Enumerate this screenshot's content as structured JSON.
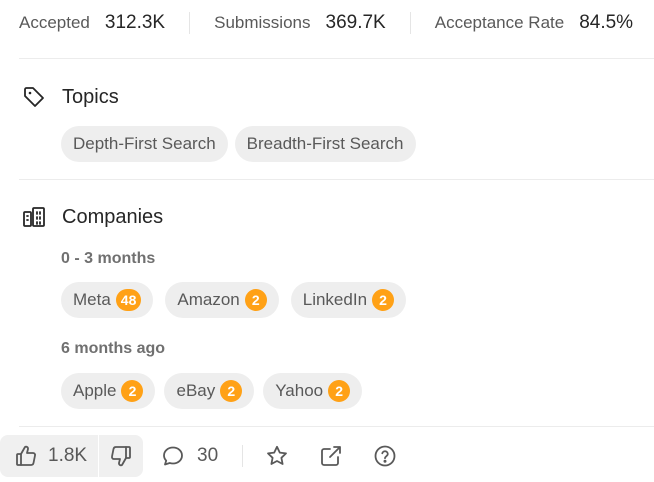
{
  "stats": [
    {
      "label": "Accepted",
      "value": "312.3K"
    },
    {
      "label": "Submissions",
      "value": "369.7K"
    },
    {
      "label": "Acceptance Rate",
      "value": "84.5%"
    }
  ],
  "topics": {
    "title": "Topics",
    "icon": "tag-icon",
    "items": [
      "Depth-First Search",
      "Breadth-First Search"
    ]
  },
  "companies": {
    "title": "Companies",
    "icon": "building-icon",
    "groups": [
      {
        "period": "0 - 3 months",
        "items": [
          {
            "name": "Meta",
            "count": "48"
          },
          {
            "name": "Amazon",
            "count": "2"
          },
          {
            "name": "LinkedIn",
            "count": "2"
          }
        ]
      },
      {
        "period": "6 months ago",
        "items": [
          {
            "name": "Apple",
            "count": "2"
          },
          {
            "name": "eBay",
            "count": "2"
          },
          {
            "name": "Yahoo",
            "count": "2"
          }
        ]
      }
    ]
  },
  "toolbar": {
    "likes": "1.8K",
    "comments": "30"
  },
  "colors": {
    "badge": "#ffa116",
    "chip_bg": "#eeeeee",
    "text_primary": "#262626",
    "text_secondary": "#595959"
  }
}
